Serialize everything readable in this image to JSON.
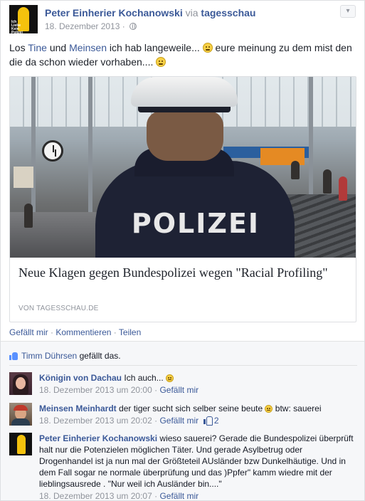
{
  "post": {
    "author": "Peter Einherier Kochanowski",
    "via_label": "via",
    "via_source": "tagesschau",
    "timestamp": "18. Dezember 2013",
    "separator": "·",
    "text_part1": "Los ",
    "tag1": "Tine",
    "text_part2": " und ",
    "tag2": "Meinsen",
    "text_part3": " ich hab langeweile... ",
    "text_part4": " eure meinung zu dem mist den die da schon wieder vorhaben.... ",
    "chevron": "▾"
  },
  "link_card": {
    "image_text": "POLIZEI",
    "title": "Neue Klagen gegen Bundespolizei wegen \"Racial Profiling\"",
    "source": "VON TAGESSCHAU.DE"
  },
  "actions": {
    "like": "Gefällt mir",
    "comment": "Kommentieren",
    "share": "Teilen",
    "sep": "·"
  },
  "likes": {
    "name": "Timm Dührsen",
    "suffix": " gefällt das."
  },
  "comments": [
    {
      "author": "Königin von Dachau",
      "text": "Ich auch... ",
      "time": "18. Dezember 2013 um 20:00",
      "like": "Gefällt mir",
      "sep": "·"
    },
    {
      "author": "Meinsen Meinhardt",
      "text_before": " der tiger sucht sich selber seine beute ",
      "text_after": " btw: sauerei",
      "time": "18. Dezember 2013 um 20:02",
      "like": "Gefällt mir",
      "sep": "·",
      "like_count": "2"
    },
    {
      "author": "Peter Einherier Kochanowski",
      "text": " wieso sauerei? Gerade die Bundespolizei überprüft halt nur die Potenzielen möglichen Täter. Und gerade Asylbetrug oder Drogenhandel ist ja nun mal der Größteteil AUsländer bzw Dunkelhäutige. Und in dem Fall sogar ne normale überprüfung und das )Ppfer\" kamm wiedre mit der lieblingsausrede . \"Nur weil ich Ausländer bin....\"",
      "time": "18. Dezember 2013 um 20:07",
      "like": "Gefällt mir",
      "sep": "·"
    }
  ],
  "avatar_logo_text": "Ich Liebe Kein Polizei",
  "colors": {
    "link": "#3b5998",
    "meta": "#90949c",
    "background": "#e9ebee"
  }
}
